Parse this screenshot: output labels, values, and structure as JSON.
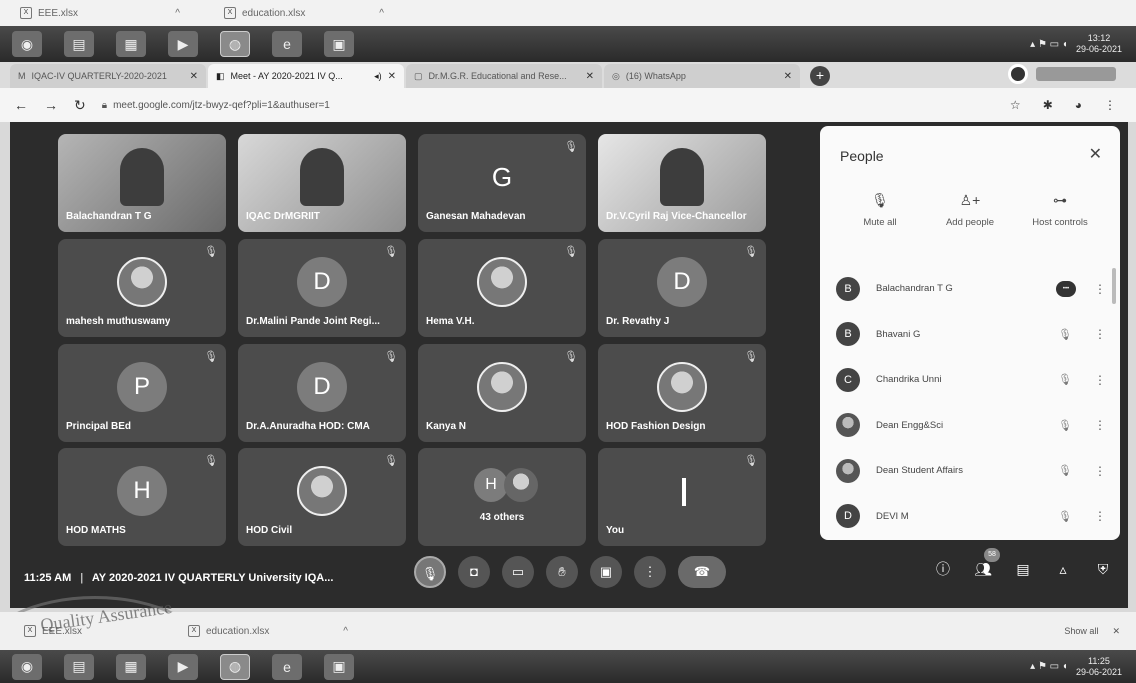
{
  "top_downloads": [
    {
      "name": "EEE.xlsx"
    },
    {
      "name": "education.xlsx"
    }
  ],
  "taskbar_top": {
    "clock_time": "13:12",
    "clock_date": "29-06-2021"
  },
  "tabs": [
    {
      "label": "IQAC-IV QUARTERLY-2020-2021",
      "icon": "gmail-icon"
    },
    {
      "label": "Meet - AY 2020-2021 IV Q...",
      "icon": "meet-icon"
    },
    {
      "label": "Dr.M.G.R. Educational and Rese...",
      "icon": "page-icon"
    },
    {
      "label": "(16) WhatsApp",
      "icon": "whatsapp-icon"
    }
  ],
  "address": {
    "url": "meet.google.com/jtz-bwyz-qef?pli=1&authuser=1"
  },
  "tiles": [
    {
      "name": "Balachandran T G",
      "kind": "video",
      "muted": false
    },
    {
      "name": "IQAC DrMGRIIT",
      "kind": "video2",
      "muted": false
    },
    {
      "name": "Ganesan Mahadevan",
      "kind": "letter",
      "letter": "G",
      "muted": true
    },
    {
      "name": "Dr.V.Cyril Raj Vice-Chancellor",
      "kind": "video3",
      "muted": false
    },
    {
      "name": "mahesh muthuswamy",
      "kind": "photo",
      "muted": true
    },
    {
      "name": "Dr.Malini Pande Joint Regi...",
      "kind": "avatar",
      "letter": "D",
      "muted": true
    },
    {
      "name": "Hema V.H.",
      "kind": "photo",
      "muted": true
    },
    {
      "name": "Dr. Revathy J",
      "kind": "avatar",
      "letter": "D",
      "muted": true
    },
    {
      "name": "Principal BEd",
      "kind": "avatar",
      "letter": "P",
      "muted": true
    },
    {
      "name": "Dr.A.Anuradha HOD: CMA",
      "kind": "avatar",
      "letter": "D",
      "muted": true
    },
    {
      "name": "Kanya N",
      "kind": "photo",
      "muted": true
    },
    {
      "name": "HOD Fashion Design",
      "kind": "photo",
      "muted": true
    },
    {
      "name": "HOD MATHS",
      "kind": "avatar",
      "letter": "H",
      "muted": true
    },
    {
      "name": "HOD Civil",
      "kind": "photo",
      "muted": true
    },
    {
      "name": "43 others",
      "kind": "others",
      "letter": "H",
      "muted": false
    },
    {
      "name": "You",
      "kind": "you",
      "muted": true
    }
  ],
  "meeting": {
    "time": "11:25 AM",
    "title": "AY 2020-2021 IV QUARTERLY University IQA...",
    "participant_count": "58"
  },
  "people_panel": {
    "title": "People",
    "actions": [
      "Mute all",
      "Add people",
      "Host controls"
    ],
    "participants": [
      {
        "initial": "B",
        "name": "Balachandran T G",
        "status": "talking"
      },
      {
        "initial": "B",
        "name": "Bhavani G",
        "status": "muted"
      },
      {
        "initial": "C",
        "name": "Chandrika Unni",
        "status": "muted"
      },
      {
        "initial": "",
        "name": "Dean Engg&Sci",
        "status": "muted",
        "photo": true
      },
      {
        "initial": "",
        "name": "Dean Student Affairs",
        "status": "muted",
        "photo": true
      },
      {
        "initial": "D",
        "name": "DEVI M",
        "status": "muted"
      }
    ]
  },
  "bottom_downloads": [
    {
      "name": "EEE.xlsx"
    },
    {
      "name": "education.xlsx"
    }
  ],
  "show_all": "Show all",
  "taskbar_bottom": {
    "clock_time": "11:25",
    "clock_date": "29-06-2021"
  },
  "stamp_text": "Quality Assurance"
}
